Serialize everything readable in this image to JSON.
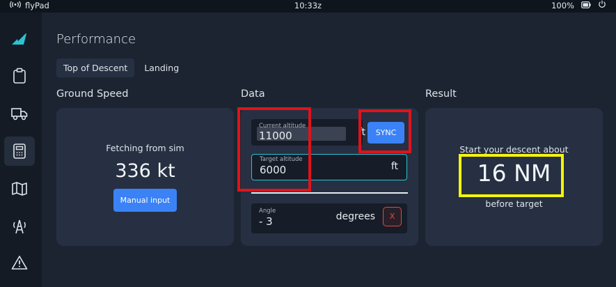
{
  "statusbar": {
    "app_name": "flyPad",
    "time": "10:33z",
    "battery": "100%"
  },
  "icons": {
    "signal": "wireless-signal-icon",
    "battery": "battery-icon",
    "power": "power-icon",
    "logo": "flybywire-logo-icon",
    "nav": [
      "clipboard-icon",
      "truck-icon",
      "calculator-icon",
      "map-icon",
      "tower-icon",
      "warning-icon"
    ]
  },
  "page": {
    "title": "Performance",
    "tabs": [
      {
        "label": "Top of Descent",
        "active": true
      },
      {
        "label": "Landing",
        "active": false
      }
    ]
  },
  "ground_speed": {
    "title": "Ground Speed",
    "status": "Fetching from sim",
    "value": "336 kt",
    "button": "Manual input"
  },
  "data": {
    "title": "Data",
    "current_altitude": {
      "label": "Current altitude",
      "value": "11000",
      "unit": "ft"
    },
    "sync_button": "SYNC",
    "target_altitude": {
      "label": "Target altitude",
      "value": "6000",
      "unit": "ft"
    },
    "angle": {
      "label": "Angle",
      "value": "- 3",
      "unit": "degrees"
    },
    "clear_button": "X"
  },
  "result": {
    "title": "Result",
    "line1": "Start your descent about",
    "distance": "16 NM",
    "line2": "before target"
  },
  "colors": {
    "background": "#1c2431",
    "card": "#263042",
    "sidebar": "#151b25",
    "accent_blue": "#3b82f6",
    "accent_cyan": "#2bc3d4",
    "danger_red": "#e04848",
    "highlight_red": "#e0131b",
    "highlight_yellow": "#f4f40c"
  }
}
